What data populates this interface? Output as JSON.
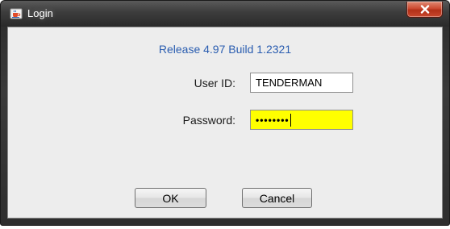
{
  "window": {
    "title": "Login",
    "title_icon": "java-cup-icon",
    "close_icon": "close-icon"
  },
  "release_text": "Release 4.97 Build 1.2321",
  "form": {
    "user_id": {
      "label": "User ID:",
      "value": "TENDERMAN"
    },
    "password": {
      "label": "Password:",
      "masked_value": "••••••••",
      "highlight_color": "#ffff00"
    }
  },
  "buttons": {
    "ok_label": "OK",
    "cancel_label": "Cancel"
  },
  "colors": {
    "release_text": "#2a5db0",
    "close_button": "#c9482e"
  }
}
